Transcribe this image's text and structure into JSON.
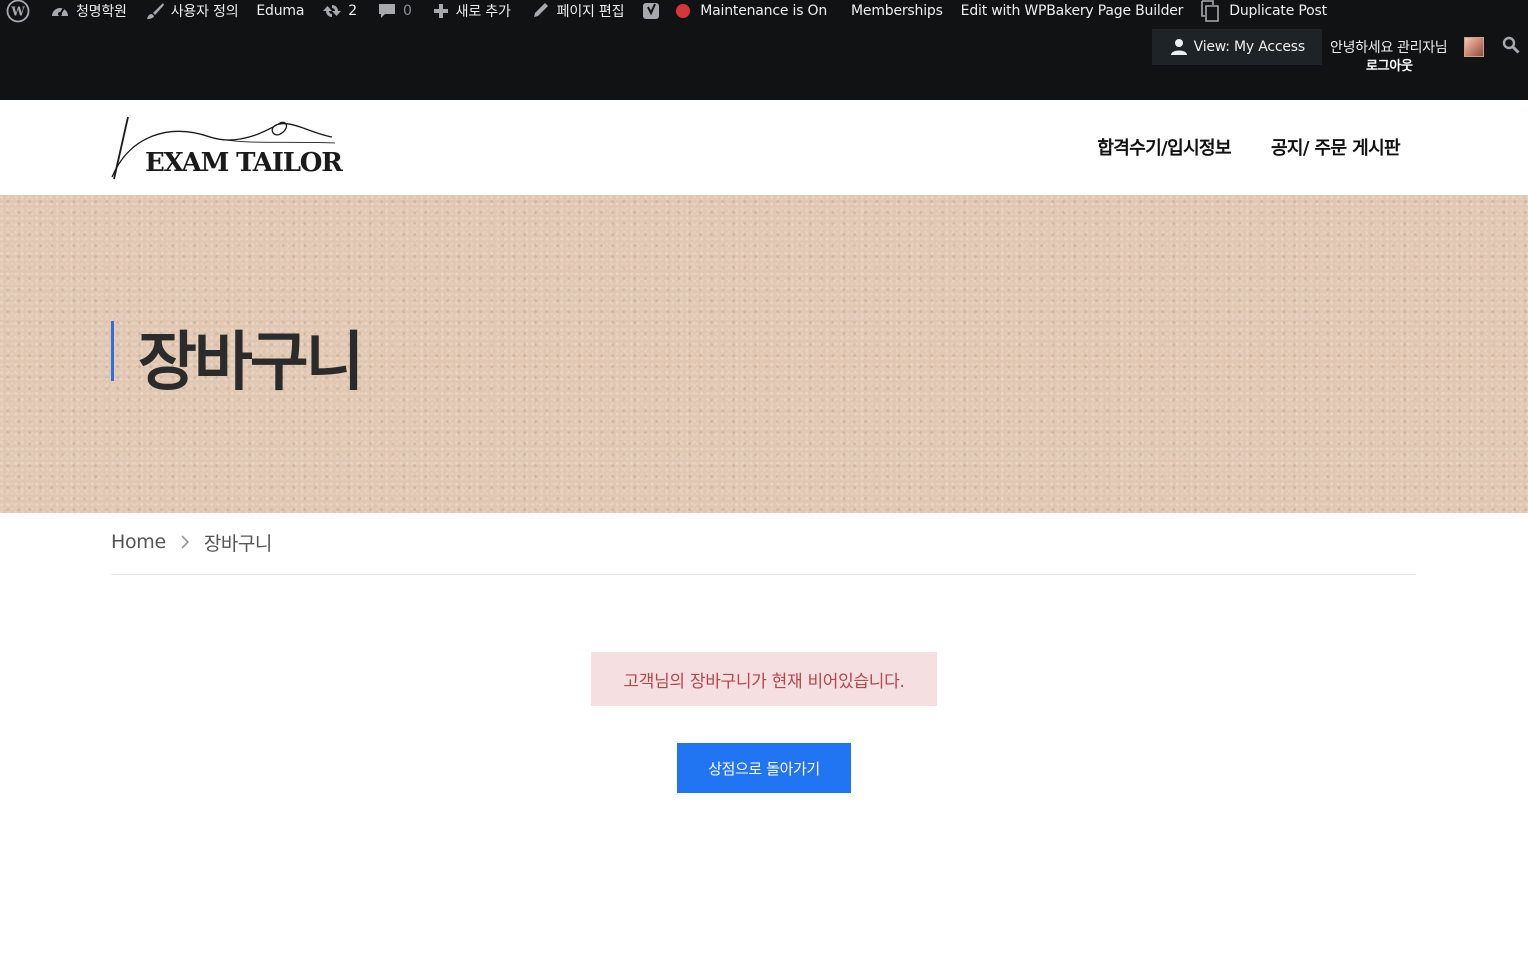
{
  "adminbar": {
    "site_name": "청명학원",
    "customize": "사용자 정의",
    "theme": "Eduma",
    "updates_count": "2",
    "comments_count": "0",
    "new_content": "새로 추가",
    "edit_page": "페이지 편집",
    "maintenance": "Maintenance is On",
    "memberships": "Memberships",
    "wpbakery": "Edit with WPBakery Page Builder",
    "duplicate": "Duplicate Post",
    "view_access": "View: My Access",
    "greeting": "안녕하세요 관리자님",
    "logout": "로그아웃",
    "maintenance_color": "#d63638"
  },
  "header": {
    "logo_text": "EXAM TAILOR",
    "nav": [
      "합격수기/입시정보",
      "공지/ 주문 게시판"
    ]
  },
  "hero": {
    "title": "장바구니",
    "accent_color": "#2e6fe0"
  },
  "breadcrumb": {
    "home": "Home",
    "current": "장바구니"
  },
  "cart": {
    "empty_message": "고객님의 장바구니가 현재 비어있습니다.",
    "return_button": "상점으로 돌아가기",
    "button_color": "#2175f3",
    "notice_bg": "#f6dfe1",
    "notice_color": "#b5474d"
  }
}
